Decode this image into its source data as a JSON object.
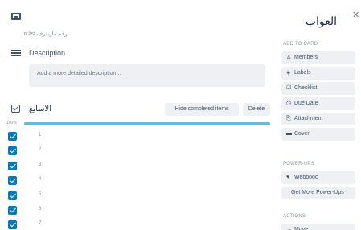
{
  "header": {
    "title": "العواب",
    "in_list": "in list رقم ماریترف",
    "close_icon": "close-icon"
  },
  "description": {
    "label": "Description",
    "placeholder": "Add a more detailed description..."
  },
  "checklist": {
    "title": "الاسابع",
    "hide_label": "Hide completed items",
    "delete_label": "Delete",
    "percent": "100%",
    "progress": 1.0,
    "items": [
      "1",
      "2",
      "3",
      "4",
      "5",
      "6",
      "7"
    ]
  },
  "sidebar": {
    "add_to_card": "ADD TO CARD",
    "add_buttons": [
      {
        "icon": "person-icon",
        "glyph": "♙",
        "label": "Members"
      },
      {
        "icon": "tag-icon",
        "glyph": "◈",
        "label": "Labels"
      },
      {
        "icon": "checklist-icon",
        "glyph": "☑",
        "label": "Checklist"
      },
      {
        "icon": "clock-icon",
        "glyph": "◷",
        "label": "Due Date"
      },
      {
        "icon": "paperclip-icon",
        "glyph": "⎘",
        "label": "Attachment"
      },
      {
        "icon": "cover-icon",
        "glyph": "▬",
        "label": "Cover"
      }
    ],
    "power_ups": "POWER-UPS",
    "power_buttons": [
      {
        "icon": "heart-icon",
        "glyph": "♥",
        "label": "Webbooo"
      },
      {
        "icon": "",
        "glyph": "",
        "label": "Get More Power-Ups"
      }
    ],
    "actions": "ACTIONS",
    "action_buttons": [
      {
        "icon": "arrow-icon",
        "glyph": "→",
        "label": "Move"
      }
    ]
  }
}
